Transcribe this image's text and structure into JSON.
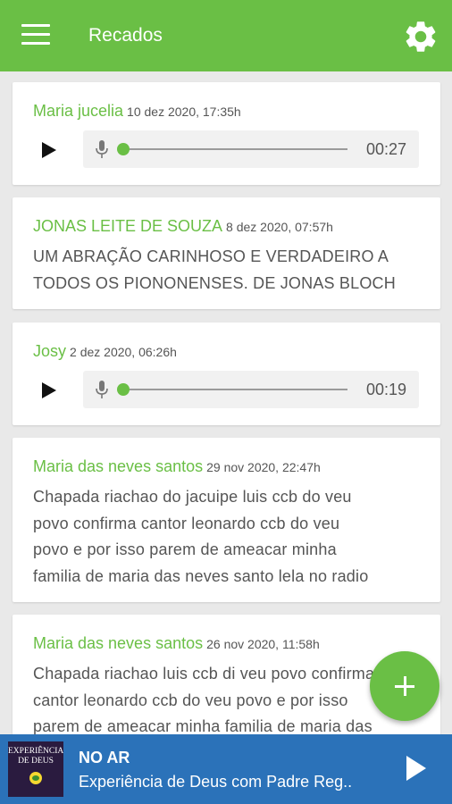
{
  "appbar": {
    "title": "Recados",
    "menu_icon": "hamburger-menu-icon",
    "settings_icon": "gear-icon",
    "color": "#6abf45"
  },
  "messages": [
    {
      "author": "Maria jucelia",
      "time": "10 dez 2020, 17:35h",
      "type": "audio",
      "duration": "00:27"
    },
    {
      "author": "JONAS LEITE DE SOUZA",
      "time": "8 dez 2020, 07:57h",
      "type": "text",
      "lines": [
        "UM ABRAÇÃO CARINHOSO E VERDADEIRO A",
        "TODOS OS PIONONENSES.  DE JONAS BLOCH"
      ]
    },
    {
      "author": "Josy",
      "time": "2 dez 2020, 06:26h",
      "type": "audio",
      "duration": "00:19"
    },
    {
      "author": "Maria das neves santos",
      "time": "29 nov 2020, 22:47h",
      "type": "text",
      "lines": [
        "Chapada riachao do jacuipe luis ccb do veu",
        "povo confirma cantor leonardo ccb do veu",
        "povo e por isso parem de ameacar minha",
        "familia de maria das neves santo lela no radio"
      ]
    },
    {
      "author": "Maria das neves santos",
      "time": "26 nov 2020, 11:58h",
      "type": "text",
      "lines": [
        "Chapada riachao luis ccb di veu povo confirma",
        "cantor leonardo ccb do veu povo e por isso",
        "parem de ameacar minha familia de maria das"
      ]
    }
  ],
  "fab": {
    "icon": "plus-icon"
  },
  "now_playing": {
    "label": "NO AR",
    "program": "Experiência de Deus com Padre Reg..",
    "cover_text": "EXPERIÊNCIA DE DEUS",
    "play_icon": "play-icon",
    "color": "#2b72b9"
  }
}
